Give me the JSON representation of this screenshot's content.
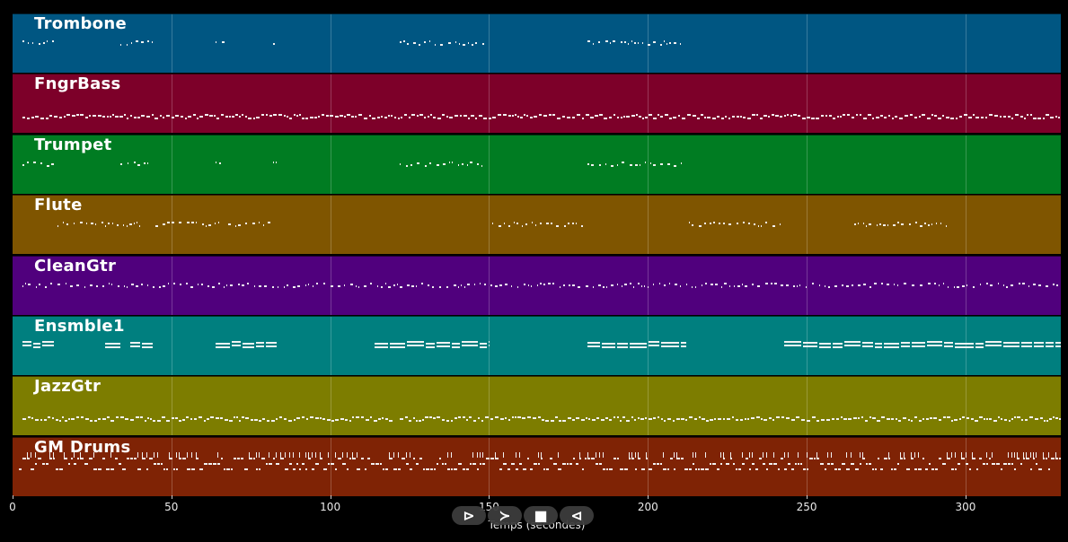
{
  "chart_data": {
    "type": "piano-roll",
    "xlabel": "Temps (secondes)",
    "xlim": [
      0,
      330
    ],
    "grid": true,
    "x_ticks": [
      0,
      50,
      100,
      150,
      200,
      250,
      300
    ],
    "x_tick_labels": [
      "0",
      "50",
      "100",
      "150",
      "200",
      "250",
      "300"
    ],
    "tracks": [
      {
        "name": "Trombone",
        "color": "#005682",
        "segments": [
          [
            3,
            13
          ],
          [
            34,
            44
          ],
          [
            64,
            67
          ],
          [
            82,
            83
          ],
          [
            122,
            149
          ],
          [
            181,
            211
          ]
        ],
        "pattern": "sparse"
      },
      {
        "name": "FngrBass",
        "color": "#7d0029",
        "segments": [
          [
            3,
            330
          ]
        ],
        "pattern": "dense"
      },
      {
        "name": "Trumpet",
        "color": "#007c22",
        "segments": [
          [
            3,
            13
          ],
          [
            34,
            44
          ],
          [
            64,
            67
          ],
          [
            82,
            83
          ],
          [
            122,
            149
          ],
          [
            181,
            211
          ]
        ],
        "pattern": "sparse"
      },
      {
        "name": "Flute",
        "color": "#7f5500",
        "segments": [
          [
            14,
            40
          ],
          [
            45,
            65
          ],
          [
            68,
            82
          ],
          [
            151,
            180
          ],
          [
            213,
            242
          ],
          [
            265,
            294
          ]
        ],
        "pattern": "sparse"
      },
      {
        "name": "CleanGtr",
        "color": "#50007d",
        "segments": [
          [
            3,
            330
          ]
        ],
        "pattern": "sparse"
      },
      {
        "name": "Ensmble1",
        "color": "#007f7f",
        "segments": [
          [
            3,
            13
          ],
          [
            29,
            34
          ],
          [
            37,
            44
          ],
          [
            64,
            83
          ],
          [
            114,
            150
          ],
          [
            181,
            212
          ],
          [
            243,
            330
          ]
        ],
        "pattern": "chords"
      },
      {
        "name": "JazzGtr",
        "color": "#7d7d00",
        "segments": [
          [
            3,
            120
          ],
          [
            122,
            330
          ]
        ],
        "pattern": "dense"
      },
      {
        "name": "GM Drums",
        "color": "#7f2305",
        "segments": [
          [
            2,
            330
          ]
        ],
        "pattern": "drums"
      }
    ]
  },
  "transport": {
    "play_label": "⊳",
    "forward_label": "≻",
    "stop_label": "■",
    "back_label": "⊲"
  }
}
